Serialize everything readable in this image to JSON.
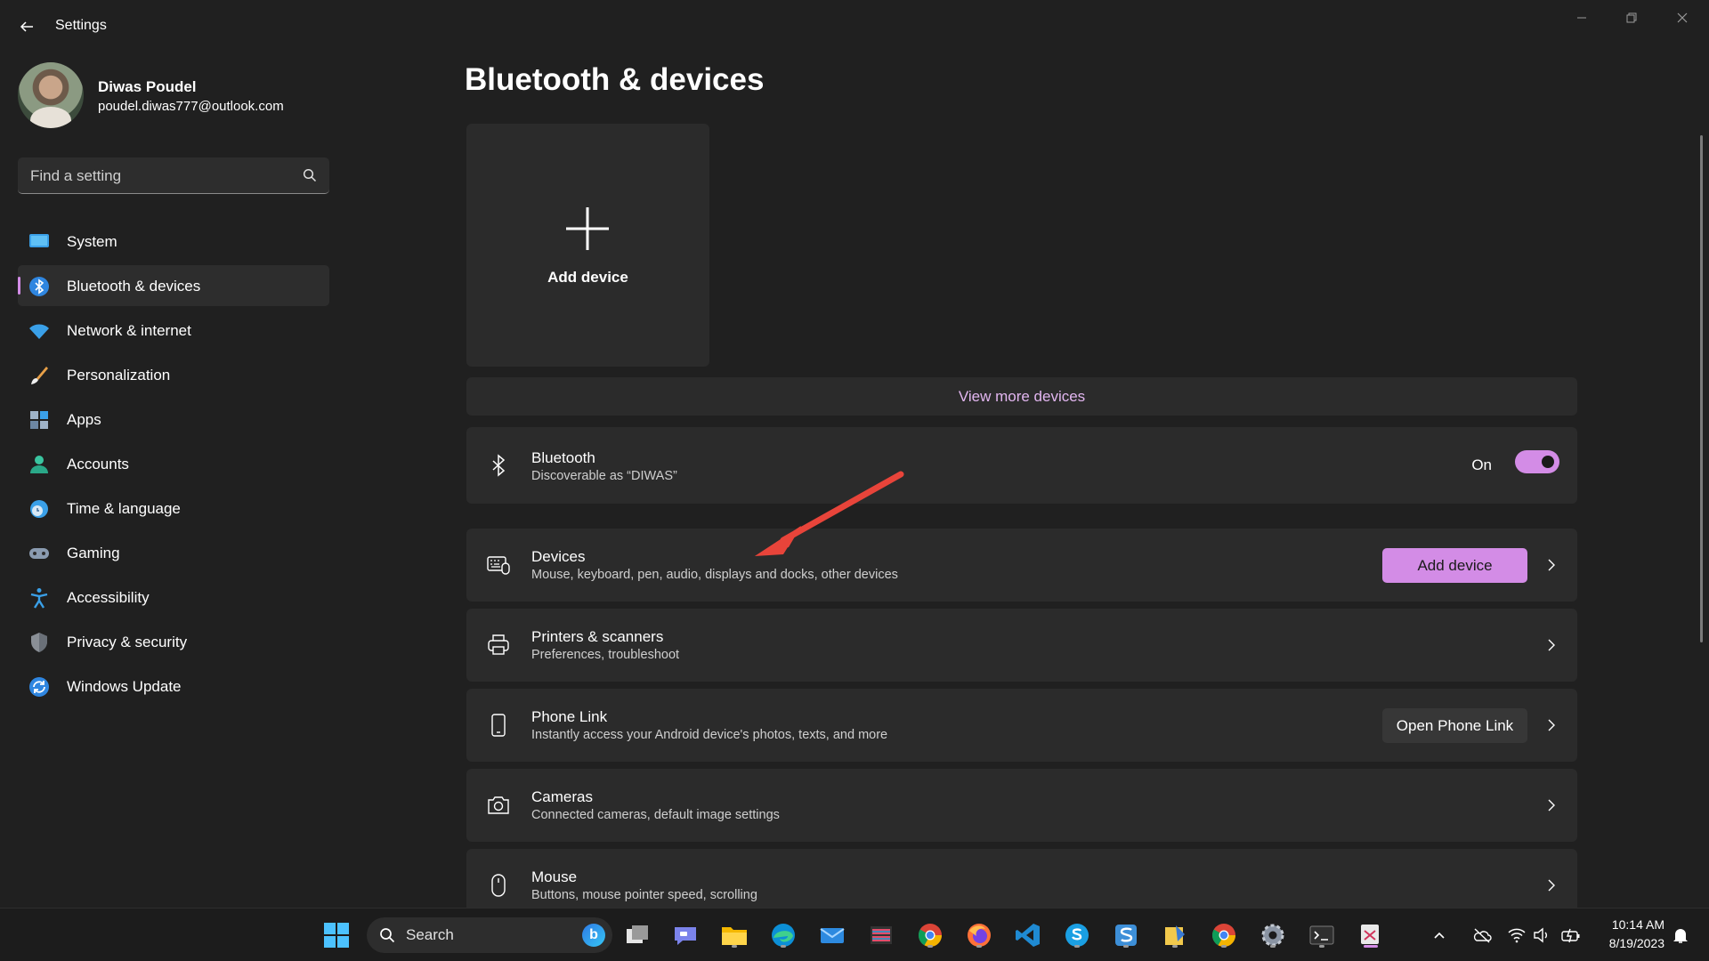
{
  "window": {
    "title": "Settings"
  },
  "profile": {
    "name": "Diwas Poudel",
    "email": "poudel.diwas777@outlook.com"
  },
  "search": {
    "placeholder": "Find a setting"
  },
  "sidebar": {
    "items": [
      {
        "label": "System",
        "icon": "system-icon"
      },
      {
        "label": "Bluetooth & devices",
        "icon": "bluetooth-icon",
        "selected": true
      },
      {
        "label": "Network & internet",
        "icon": "wifi-icon"
      },
      {
        "label": "Personalization",
        "icon": "brush-icon"
      },
      {
        "label": "Apps",
        "icon": "apps-icon"
      },
      {
        "label": "Accounts",
        "icon": "accounts-icon"
      },
      {
        "label": "Time & language",
        "icon": "globe-clock-icon"
      },
      {
        "label": "Gaming",
        "icon": "gamepad-icon"
      },
      {
        "label": "Accessibility",
        "icon": "accessibility-icon"
      },
      {
        "label": "Privacy & security",
        "icon": "shield-icon"
      },
      {
        "label": "Windows Update",
        "icon": "update-icon"
      }
    ]
  },
  "main": {
    "title": "Bluetooth & devices",
    "add_tile_label": "Add device",
    "view_more": "View more devices",
    "bluetooth": {
      "title": "Bluetooth",
      "subtitle": "Discoverable as “DIWAS”",
      "state_label": "On",
      "enabled": true
    },
    "devices": {
      "title": "Devices",
      "subtitle": "Mouse, keyboard, pen, audio, displays and docks, other devices",
      "button": "Add device"
    },
    "printers": {
      "title": "Printers & scanners",
      "subtitle": "Preferences, troubleshoot"
    },
    "phone_link": {
      "title": "Phone Link",
      "subtitle": "Instantly access your Android device's photos, texts, and more",
      "button": "Open Phone Link"
    },
    "cameras": {
      "title": "Cameras",
      "subtitle": "Connected cameras, default image settings"
    },
    "mouse": {
      "title": "Mouse",
      "subtitle": "Buttons, mouse pointer speed, scrolling"
    }
  },
  "taskbar": {
    "search_label": "Search",
    "time": "10:14 AM",
    "date": "8/19/2023"
  },
  "colors": {
    "accent": "#d38ce6",
    "background": "#202020",
    "card": "#2b2b2b",
    "annotation_arrow": "#e8443a"
  }
}
